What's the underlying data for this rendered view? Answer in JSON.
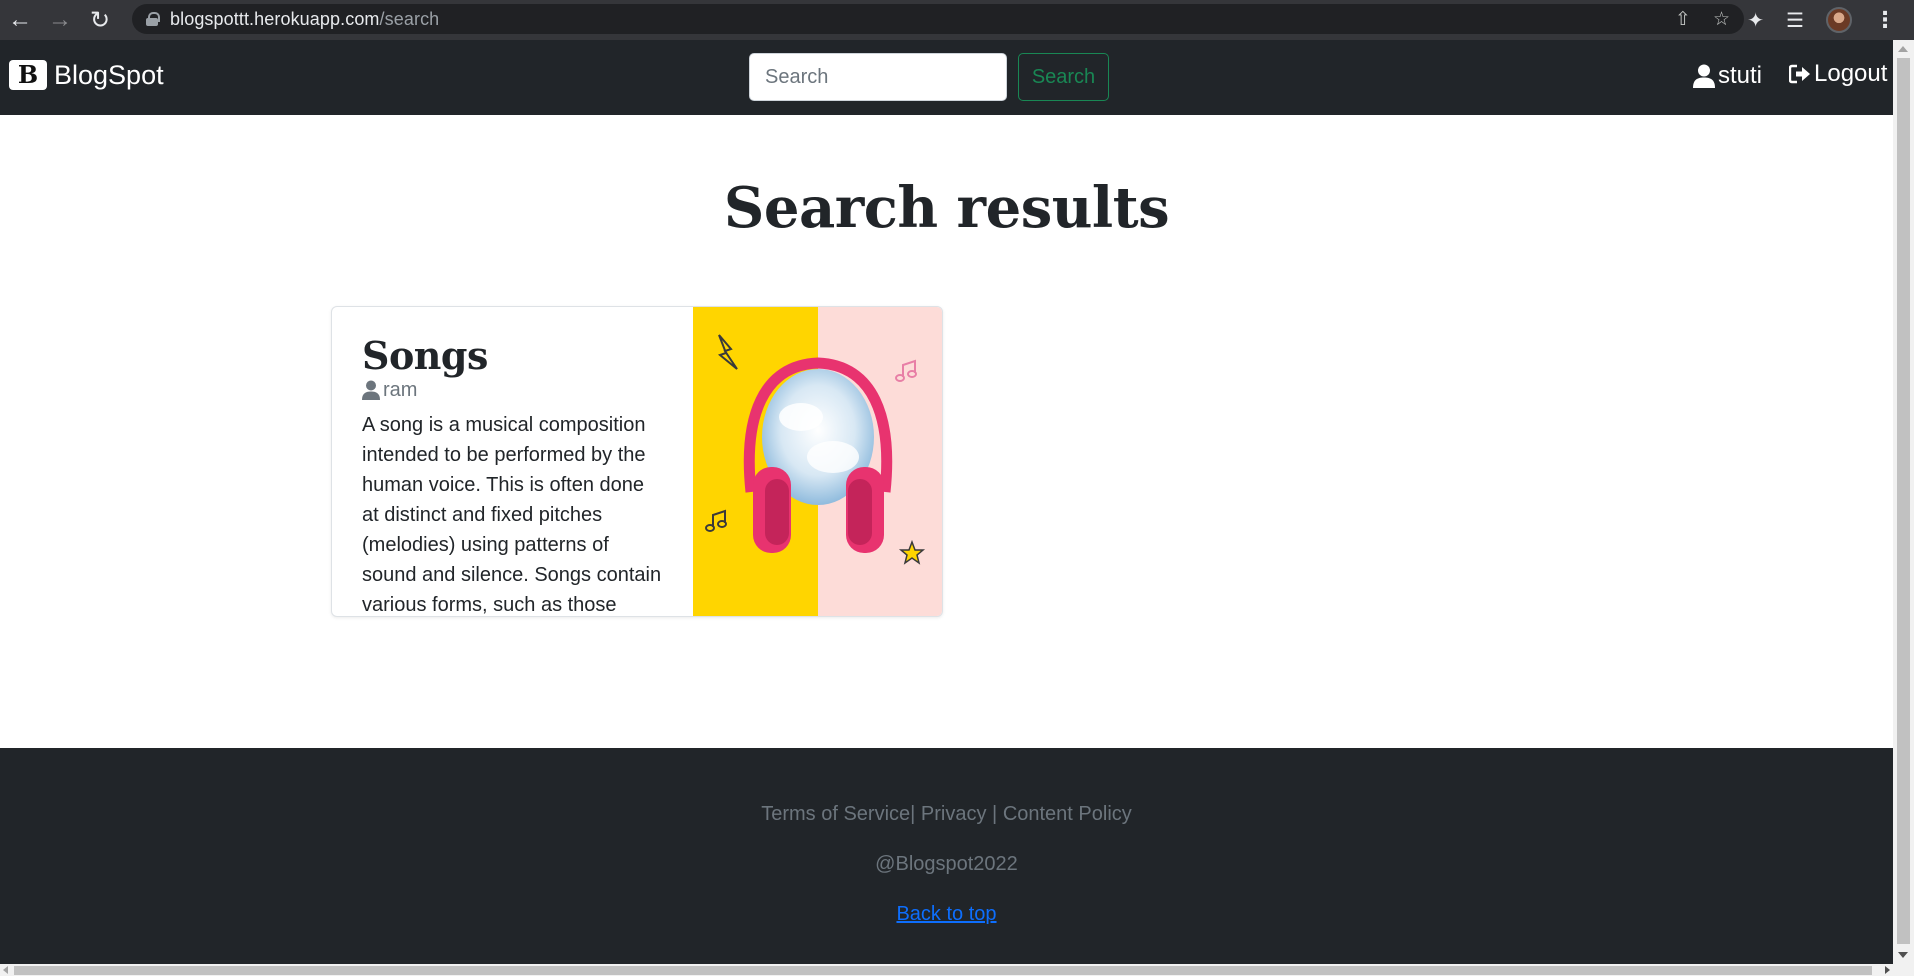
{
  "browser": {
    "url_host": "blogspottt.herokuapp.com",
    "url_path": "/search",
    "icons": [
      "back-icon",
      "forward-icon",
      "reload-icon",
      "lock-icon",
      "share-icon",
      "star-icon",
      "extensions-icon",
      "reading-list-icon",
      "profile-avatar",
      "menu-icon"
    ]
  },
  "navbar": {
    "brand_logo_letter": "B",
    "brand": "BlogSpot",
    "search_placeholder": "Search",
    "search_value": "",
    "search_button": "Search",
    "user": "stuti",
    "logout": "Logout"
  },
  "main": {
    "heading": "Search results",
    "results": [
      {
        "title": "Songs",
        "author": "ram",
        "excerpt": "A song is a musical composition intended to be performed by the human voice. This is often done at distinct and fixed pitches (melodies) using patterns of sound and silence. Songs contain various forms, such as those"
      }
    ]
  },
  "footer": {
    "terms": "Terms of Service",
    "privacy": "Privacy",
    "content_policy": "Content Policy",
    "copyright": "@Blogspot2022",
    "back_to_top": "Back to top"
  },
  "colors": {
    "navbar_bg": "#212529",
    "search_btn": "#198754",
    "link": "#0d6efd",
    "muted": "#6c757d",
    "card_yellow": "#ffd500",
    "card_pink": "#fddcd8",
    "headphones_pink": "#e8336f"
  }
}
